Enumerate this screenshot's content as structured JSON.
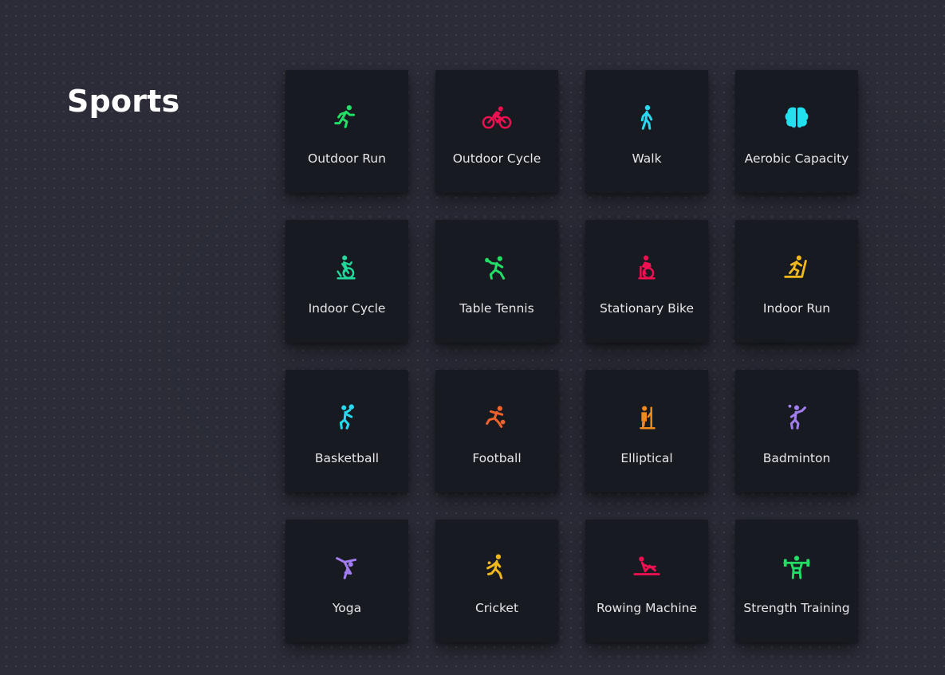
{
  "page": {
    "title": "Sports"
  },
  "tiles": [
    {
      "label": "Outdoor Run",
      "icon": "running-icon",
      "color": "#22dd66"
    },
    {
      "label": "Outdoor Cycle",
      "icon": "bicycle-icon",
      "color": "#ee1050"
    },
    {
      "label": "Walk",
      "icon": "walking-icon",
      "color": "#29d7ee"
    },
    {
      "label": "Aerobic Capacity",
      "icon": "brain-icon",
      "color": "#22e0ee"
    },
    {
      "label": "Indoor Cycle",
      "icon": "exercise-bike-icon",
      "color": "#22d89a"
    },
    {
      "label": "Table Tennis",
      "icon": "table-tennis-icon",
      "color": "#22dd66"
    },
    {
      "label": "Stationary Bike",
      "icon": "stationary-bike-icon",
      "color": "#ee1050"
    },
    {
      "label": "Indoor Run",
      "icon": "treadmill-icon",
      "color": "#f0b81c"
    },
    {
      "label": "Basketball",
      "icon": "basketball-player-icon",
      "color": "#29d7ee"
    },
    {
      "label": "Football",
      "icon": "football-player-icon",
      "color": "#f0622c"
    },
    {
      "label": "Elliptical",
      "icon": "elliptical-icon",
      "color": "#f08a1c"
    },
    {
      "label": "Badminton",
      "icon": "badminton-icon",
      "color": "#a27df0"
    },
    {
      "label": "Yoga",
      "icon": "yoga-icon",
      "color": "#a27df0"
    },
    {
      "label": "Cricket",
      "icon": "cricket-icon",
      "color": "#f0b81c"
    },
    {
      "label": "Rowing Machine",
      "icon": "rowing-machine-icon",
      "color": "#ee1050"
    },
    {
      "label": "Strength Training",
      "icon": "weightlifting-icon",
      "color": "#22dd66"
    }
  ]
}
